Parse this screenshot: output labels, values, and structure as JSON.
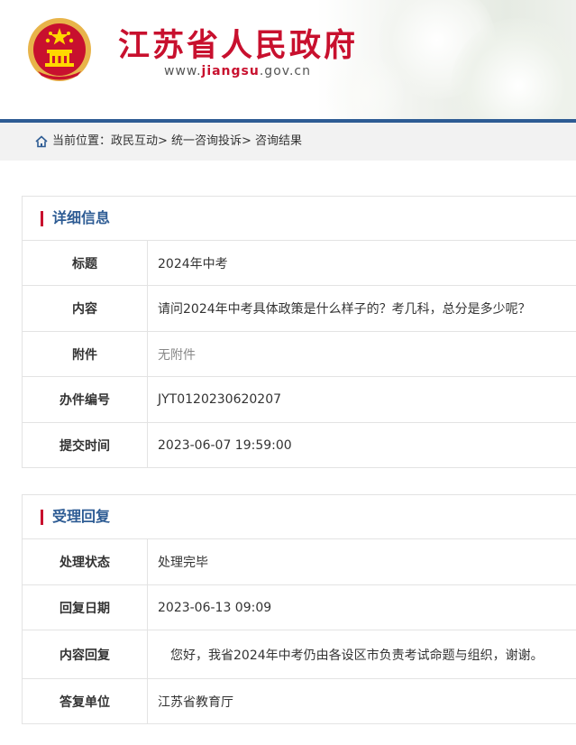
{
  "header": {
    "site_title": "江苏省人民政府",
    "url_prefix": "www.",
    "url_main": "jiangsu",
    "url_suffix": ".gov.cn",
    "emblem_icon": "national-emblem-icon"
  },
  "breadcrumb": {
    "icon": "home-icon",
    "text": "当前位置：政民互动> 统一咨询投诉> 咨询结果"
  },
  "detail": {
    "title": "详细信息",
    "rows": [
      {
        "label": "标题",
        "value": "2024年中考"
      },
      {
        "label": "内容",
        "value": "请问2024年中考具体政策是什么样子的？考几科，总分是多少呢？"
      },
      {
        "label": "附件",
        "value": "无附件"
      },
      {
        "label": "办件编号",
        "value": "JYT0120230620207"
      },
      {
        "label": "提交时间",
        "value": "2023-06-07 19:59:00"
      }
    ]
  },
  "reply": {
    "title": "受理回复",
    "rows": [
      {
        "label": "处理状态",
        "value": "处理完毕"
      },
      {
        "label": "回复日期",
        "value": "2023-06-13 09:09"
      },
      {
        "label": "内容回复",
        "value": "　您好，我省2024年中考仍由各设区市负责考试命题与组织，谢谢。"
      },
      {
        "label": "答复单位",
        "value": "江苏省教育厅"
      }
    ]
  },
  "colors": {
    "brand_red": "#c8102e",
    "brand_blue": "#2e5c94"
  }
}
